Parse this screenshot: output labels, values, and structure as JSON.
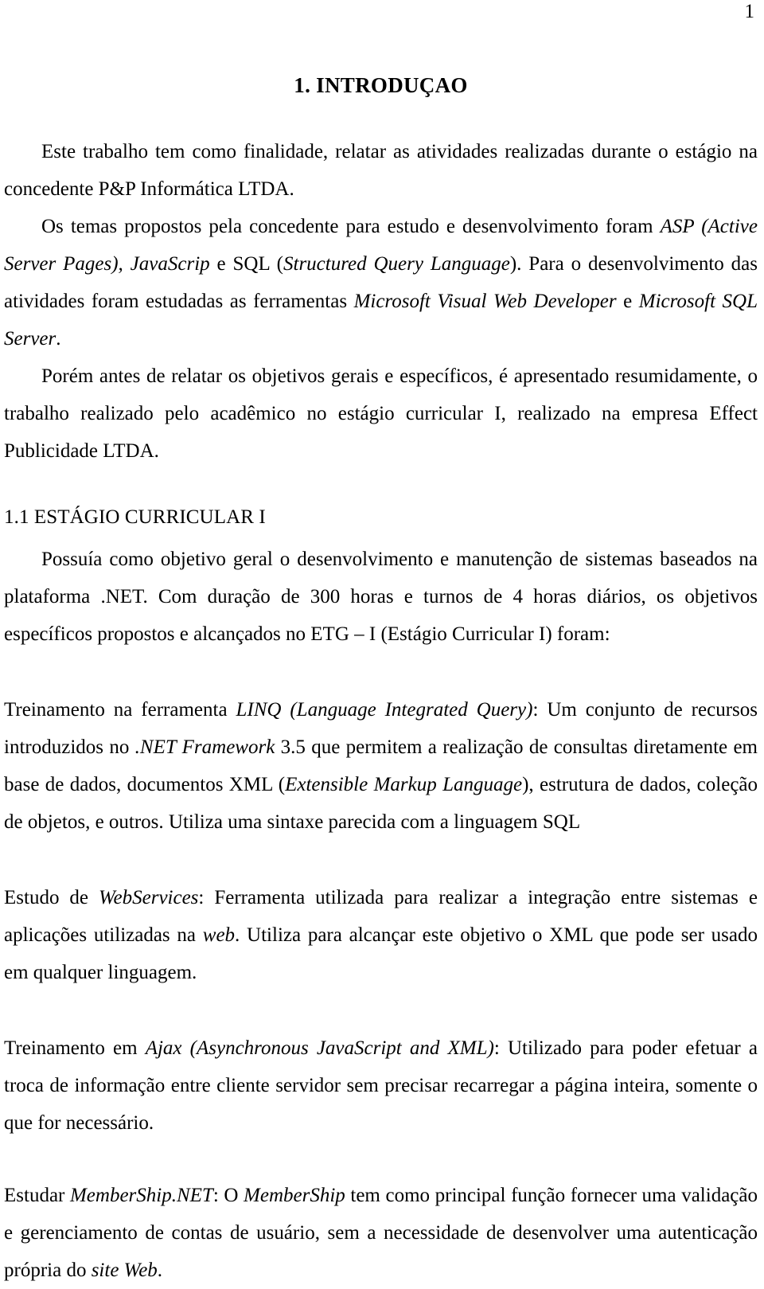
{
  "document": {
    "page_number": "1",
    "heading": "1. INTRODUÇAO",
    "subheading": "1.1 ESTÁGIO CURRICULAR I"
  },
  "paragraphs": {
    "p1": {
      "text": "Este trabalho tem como finalidade, relatar as atividades realizadas durante o estágio na concedente P&P Informática LTDA."
    },
    "p2": {
      "seg1": "Os temas propostos pela concedente para estudo e desenvolvimento foram ",
      "em1": "ASP (Active Server Pages), JavaScrip",
      "seg2": " e SQL (",
      "em2": "Structured Query Language",
      "seg3": "). Para o desenvolvimento das atividades foram estudadas as ferramentas ",
      "em3": "Microsoft Visual Web Developer",
      "seg4": " e ",
      "em4": "Microsoft SQL Server",
      "seg5": "."
    },
    "p3": {
      "text": "Porém antes de relatar os objetivos gerais e específicos, é apresentado resumidamente, o trabalho realizado pelo acadêmico no estágio curricular I, realizado na empresa Effect Publicidade LTDA."
    },
    "p4": {
      "text": "Possuía como objetivo geral o desenvolvimento e manutenção de sistemas baseados na plataforma .NET. Com duração de 300 horas e turnos de 4 horas diários, os objetivos específicos propostos e alcançados no ETG – I (Estágio Curricular I) foram:"
    },
    "p5": {
      "seg1": "Treinamento na ferramenta ",
      "em1": "LINQ (Language Integrated Query)",
      "seg2": ": Um conjunto de recursos introduzidos no ",
      "em2": ".NET Framework",
      "seg3": " 3.5 que permitem a realização de consultas diretamente em base de dados, documentos XML (",
      "em3": "Extensible Markup Language",
      "seg4": "), estrutura de dados, coleção de objetos, e outros. Utiliza uma sintaxe parecida com a linguagem SQL"
    },
    "p6": {
      "seg1": "Estudo de ",
      "em1": "WebServices",
      "seg2": ": Ferramenta utilizada para realizar a integração entre sistemas e aplicações utilizadas na ",
      "em2": "web",
      "seg3": ". Utiliza para alcançar este objetivo o XML que pode ser usado em qualquer linguagem."
    },
    "p7": {
      "seg1": "Treinamento em ",
      "em1": "Ajax (Asynchronous JavaScript and XML)",
      "seg2": ": Utilizado para poder efetuar a troca de informação entre cliente servidor sem precisar recarregar a página inteira, somente o que for necessário."
    },
    "p8": {
      "seg1": "Estudar ",
      "em1": "MemberShip.NET",
      "seg2": ": O ",
      "em2": "MemberShip",
      "seg3": " tem como principal função fornecer uma validação e gerenciamento de contas de usuário, sem a necessidade de desenvolver uma autenticação própria do ",
      "em3": "site Web",
      "seg4": "."
    }
  }
}
